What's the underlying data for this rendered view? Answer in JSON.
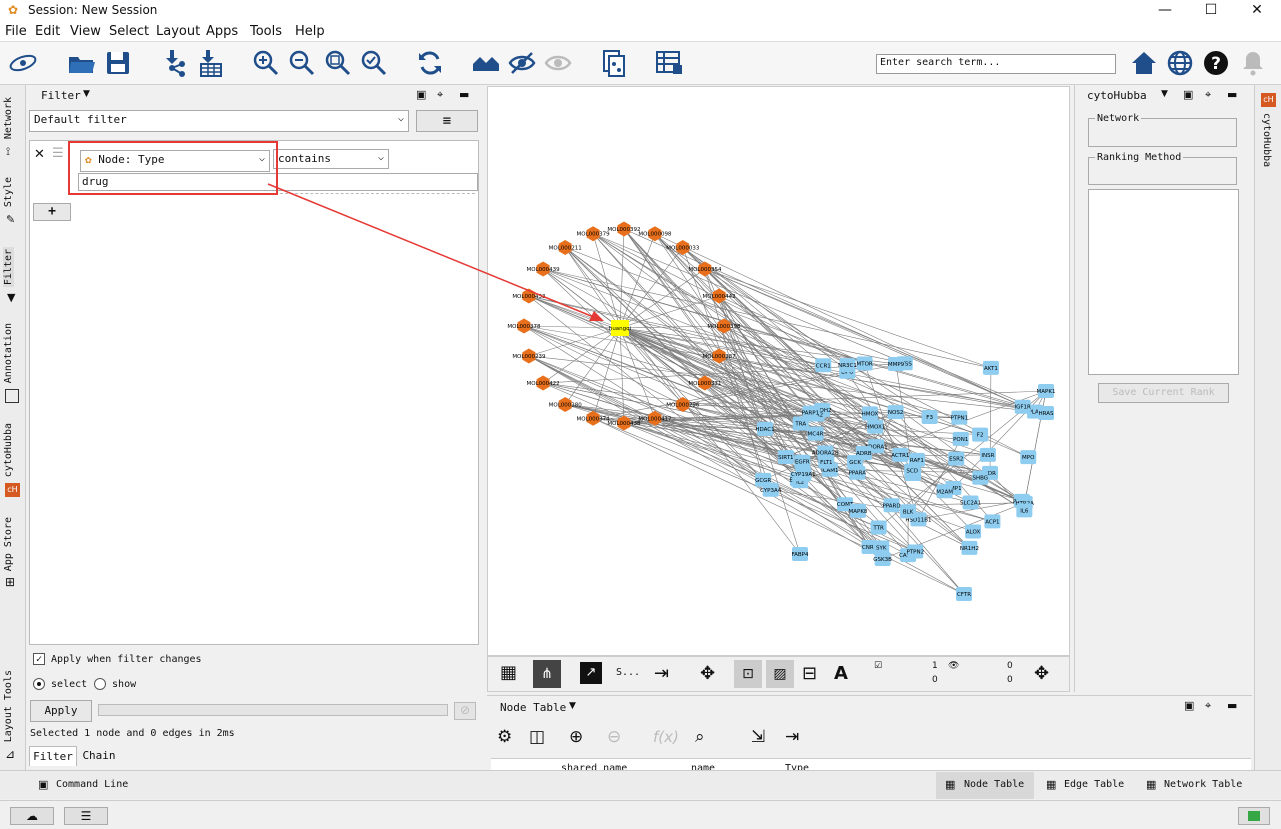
{
  "window": {
    "title": "Session: New Session"
  },
  "menubar": [
    "File",
    "Edit",
    "View",
    "Select",
    "Layout",
    "Apps",
    "Tools",
    "Help"
  ],
  "toolbar": {
    "search_placeholder": "Enter search term..."
  },
  "left_tabs": [
    "Network",
    "Style",
    "Filter",
    "Annotation",
    "cytoHubba",
    "App Store",
    "Layout Tools"
  ],
  "filter_panel": {
    "title": "Filter",
    "default_filter": "Default filter",
    "condition_column": "Node: Type",
    "condition_operator": "contains",
    "condition_value": "drug",
    "apply_when_changes_label": "Apply when filter changes",
    "select_label": "select",
    "show_label": "show",
    "apply_button": "Apply",
    "status_text": "Selected 1 node and 0 edges in 2ms",
    "tabs": [
      "Filter",
      "Chain"
    ]
  },
  "canvas": {
    "highlighted_node": "huangqi",
    "compound_nodes": [
      "MOL000392",
      "MOL000098",
      "MOL000033",
      "MOL000354",
      "MOL000442",
      "MOL000398",
      "MOL000387",
      "MOL000371",
      "MOL000296",
      "MOL000417",
      "MOL000438",
      "MOL000374",
      "MOL000380",
      "MOL000422",
      "MOL000239",
      "MOL000378",
      "MOL000433",
      "MOL000439",
      "MOL000211",
      "MOL000379"
    ],
    "target_nodes": [
      "SIRT1",
      "MMP1",
      "EP300",
      "PRSS1",
      "PIK3CA",
      "CNR1",
      "HMOX1",
      "ADORA2B",
      "HMOX",
      "TRA",
      "SELE",
      "PLAT",
      "SLC2A1",
      "PON1",
      "MAPK1",
      "HRAS",
      "NR1H2",
      "ICAM1",
      "MC4R",
      "ALOX",
      "COMT",
      "HTR2A",
      "CASP3",
      "FLT1",
      "ALDH2",
      "CTSS",
      "M2AM",
      "GCK",
      "VDR",
      "LIPG",
      "F2",
      "IL2",
      "CYP3A4",
      "CYP19A1",
      "PPARD",
      "NOS2",
      "SYK",
      "AKT1",
      "IGF1R",
      "MMP9",
      "ADORA1",
      "MAPK8",
      "HSD11B1",
      "NR3C1",
      "GSK3B",
      "INSR",
      "SLC5A2",
      "IL6",
      "GCGR",
      "PARP1",
      "ACP1",
      "PTPN1",
      "ESR2",
      "MTOR",
      "CCR1",
      "PTPN2",
      "SCD",
      "RAF1",
      "HDAC1",
      "F3",
      "ADRB",
      "TTR",
      "SHBG",
      "BLK",
      "FABP4",
      "ACTR1",
      "CFTR",
      "PPARA",
      "EGFR",
      "MPO"
    ],
    "readout": {
      "a1": "1",
      "a2": "0",
      "b1": "0",
      "b2": "0"
    }
  },
  "right_panel": {
    "title": "cytoHubba",
    "network_label": "Network",
    "ranking_label": "Ranking Method",
    "save_button": "Save Current Rank"
  },
  "right_tab": "cytoHubba",
  "table_panel": {
    "title": "Node Table",
    "columns": [
      "shared name",
      "name",
      "Type"
    ]
  },
  "bottom_tabs": {
    "command_line": "Command Line",
    "node_table": "Node Table",
    "edge_table": "Edge Table",
    "network_table": "Network Table"
  },
  "canvas_toolbar": {
    "more": "S..."
  },
  "colors": {
    "compound": "#e8701c",
    "target": "#8ecdf0",
    "selected": "#ffff00",
    "annotation": "#e53935",
    "edge": "#7a7a7a"
  }
}
